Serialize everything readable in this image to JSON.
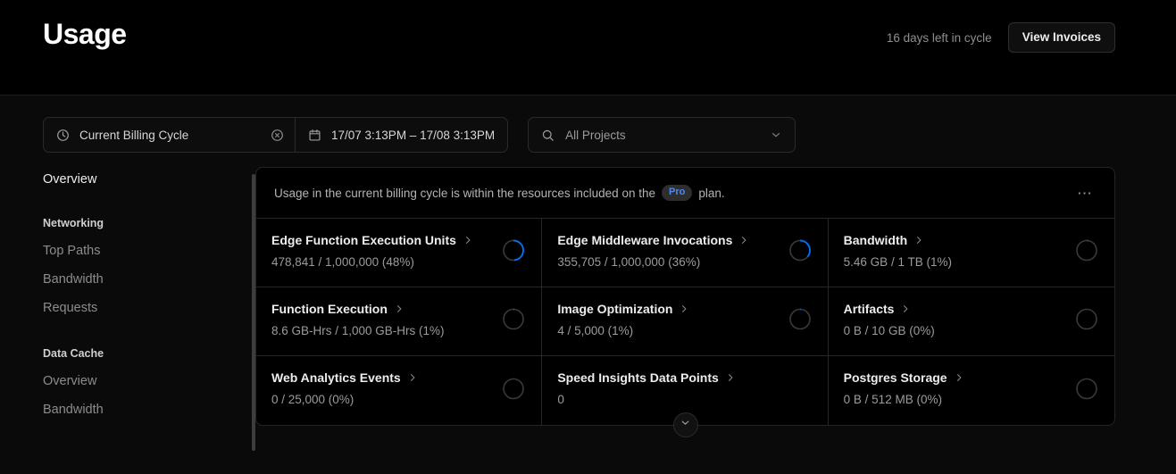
{
  "header": {
    "title": "Usage",
    "cycle_note": "16 days left in cycle",
    "invoices_label": "View Invoices"
  },
  "filters": {
    "cycle": {
      "icon": "clock-icon",
      "label": "Current Billing Cycle",
      "clear_icon": "clear-circle-icon"
    },
    "date_range": {
      "icon": "calendar-icon",
      "label": "17/07 3:13PM – 17/08 3:13PM"
    },
    "projects": {
      "icon": "search-icon",
      "value": "All Projects",
      "placeholder": "All Projects",
      "chevron_icon": "chevron-down-icon"
    }
  },
  "sidebar": {
    "overview": "Overview",
    "sections": [
      {
        "title": "Networking",
        "items": [
          "Top Paths",
          "Bandwidth",
          "Requests"
        ]
      },
      {
        "title": "Data Cache",
        "items": [
          "Overview",
          "Bandwidth"
        ]
      }
    ]
  },
  "main": {
    "notice": {
      "text_before": "Usage in the current billing cycle is within the resources included on the",
      "badge": "Pro",
      "text_after": "plan.",
      "menu_icon": "ellipsis-icon"
    },
    "expand_icon": "chevron-down-icon",
    "accent_color": "#0070f3",
    "cards": [
      {
        "title": "Edge Function Execution Units",
        "detail": "478,841 / 1,000,000 (48%)",
        "percent": 48,
        "gauge": true
      },
      {
        "title": "Edge Middleware Invocations",
        "detail": "355,705 / 1,000,000 (36%)",
        "percent": 36,
        "gauge": true
      },
      {
        "title": "Bandwidth",
        "detail": "5.46 GB / 1 TB (1%)",
        "percent": 1,
        "gauge": true
      },
      {
        "title": "Function Execution",
        "detail": "8.6 GB-Hrs / 1,000 GB-Hrs (1%)",
        "percent": 1,
        "gauge": true
      },
      {
        "title": "Image Optimization",
        "detail": "4 / 5,000 (1%)",
        "percent": 1,
        "gauge": true
      },
      {
        "title": "Artifacts",
        "detail": "0 B / 10 GB (0%)",
        "percent": 0,
        "gauge": true
      },
      {
        "title": "Web Analytics Events",
        "detail": "0 / 25,000 (0%)",
        "percent": 0,
        "gauge": true
      },
      {
        "title": "Speed Insights Data Points",
        "detail": "0",
        "percent": 0,
        "gauge": false
      },
      {
        "title": "Postgres Storage",
        "detail": "0 B / 512 MB (0%)",
        "percent": 0,
        "gauge": true
      }
    ]
  }
}
